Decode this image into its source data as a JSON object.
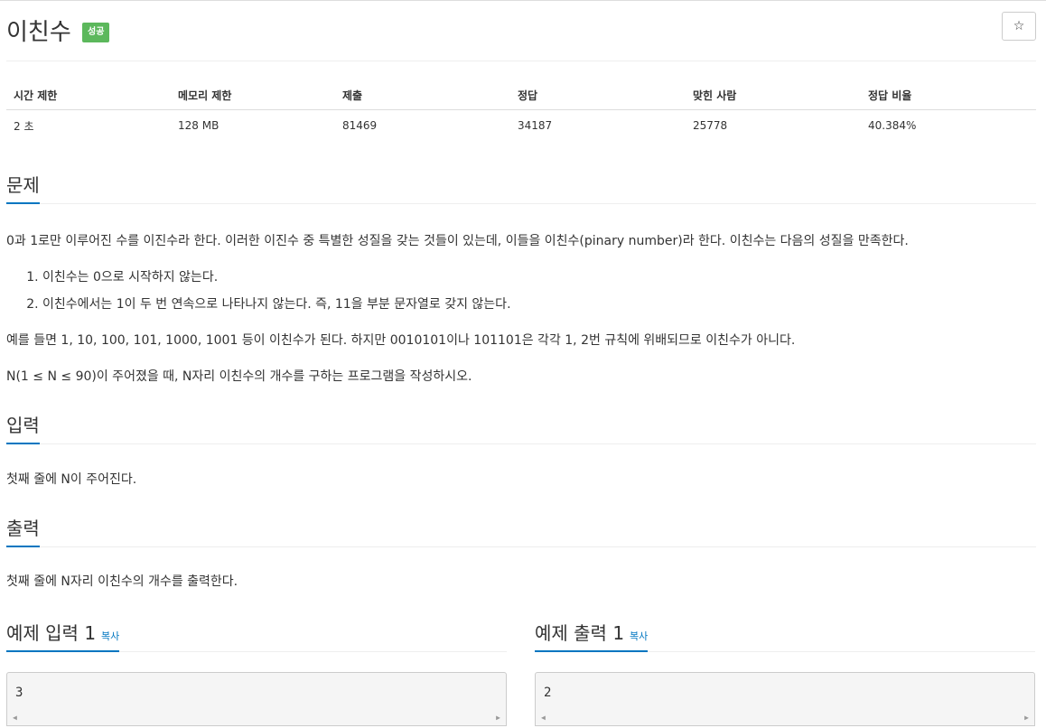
{
  "title": "이친수",
  "badge": "성공",
  "star": "☆",
  "stats": {
    "headers": [
      "시간 제한",
      "메모리 제한",
      "제출",
      "정답",
      "맞힌 사람",
      "정답 비율"
    ],
    "values": [
      "2 초",
      "128 MB",
      "81469",
      "34187",
      "25778",
      "40.384%"
    ]
  },
  "problem": {
    "heading": "문제",
    "intro": "0과 1로만 이루어진 수를 이진수라 한다. 이러한 이진수 중 특별한 성질을 갖는 것들이 있는데, 이들을 이친수(pinary number)라 한다. 이친수는 다음의 성질을 만족한다.",
    "conditions": [
      "이친수는 0으로 시작하지 않는다.",
      "이친수에서는 1이 두 번 연속으로 나타나지 않는다. 즉, 11을 부분 문자열로 갖지 않는다."
    ],
    "example": "예를 들면 1, 10, 100, 101, 1000, 1001 등이 이친수가 된다. 하지만 0010101이나 101101은 각각 1, 2번 규칙에 위배되므로 이친수가 아니다.",
    "task": "N(1 ≤ N ≤ 90)이 주어졌을 때, N자리 이친수의 개수를 구하는 프로그램을 작성하시오."
  },
  "input": {
    "heading": "입력",
    "text": "첫째 줄에 N이 주어진다."
  },
  "output": {
    "heading": "출력",
    "text": "첫째 줄에 N자리 이친수의 개수를 출력한다."
  },
  "sample_input": {
    "heading": "예제 입력 1",
    "copy": "복사",
    "value": "3"
  },
  "sample_output": {
    "heading": "예제 출력 1",
    "copy": "복사",
    "value": "2"
  }
}
